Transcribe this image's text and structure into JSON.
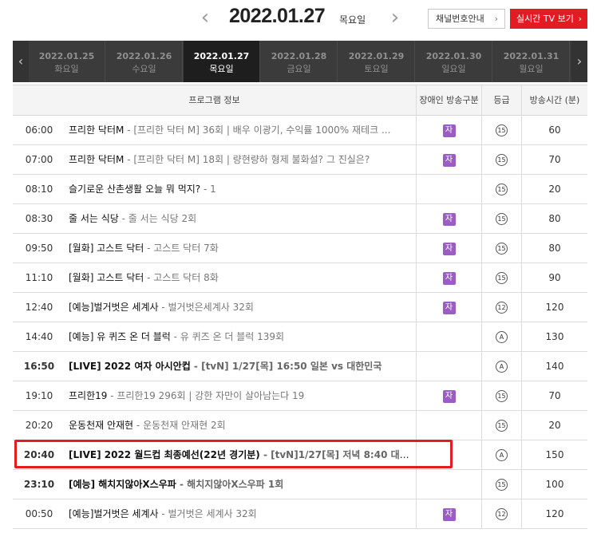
{
  "header": {
    "prev_icon": "chevron-left-icon",
    "next_icon": "chevron-right-icon",
    "date": "2022.01.27",
    "day_of_week": "목요일",
    "channel_guide_label": "채널번호안내",
    "live_tv_label": "실시간 TV 보기",
    "live_tv_color": "#e31c24"
  },
  "tabs": [
    {
      "date": "2022.01.25",
      "dow": "화요일"
    },
    {
      "date": "2022.01.26",
      "dow": "수요일"
    },
    {
      "date": "2022.01.27",
      "dow": "목요일"
    },
    {
      "date": "2022.01.28",
      "dow": "금요일"
    },
    {
      "date": "2022.01.29",
      "dow": "토요일"
    },
    {
      "date": "2022.01.30",
      "dow": "일요일"
    },
    {
      "date": "2022.01.31",
      "dow": "월요일"
    }
  ],
  "columns": {
    "program": "프로그램 정보",
    "accessibility": "장애인 방송구분",
    "rating": "등급",
    "duration": "방송시간 (분)"
  },
  "rows": [
    {
      "time": "06:00",
      "title": "프리한 닥터M",
      "sub": " - [프리한 닥터 M] 36회 | 배우 이광기, 수익률 1000% 재테크 ...",
      "cc": "자",
      "rating": "15",
      "duration": "60",
      "live": false
    },
    {
      "time": "07:00",
      "title": "프리한 닥터M",
      "sub": " - [프리한 닥터 M] 18회 | 량현량하 형제 불화설? 그 진실은?",
      "cc": "자",
      "rating": "15",
      "duration": "70",
      "live": false
    },
    {
      "time": "08:10",
      "title": "슬기로운 산촌생활 오늘 뭐 먹지?",
      "sub": " - 1",
      "cc": "",
      "rating": "15",
      "duration": "20",
      "live": false
    },
    {
      "time": "08:30",
      "title": "줄 서는 식당",
      "sub": " - 줄 서는 식당 2회",
      "cc": "자",
      "rating": "15",
      "duration": "80",
      "live": false
    },
    {
      "time": "09:50",
      "title": "[월화] 고스트 닥터",
      "sub": " - 고스트 닥터 7화",
      "cc": "자",
      "rating": "15",
      "duration": "80",
      "live": false
    },
    {
      "time": "11:10",
      "title": "[월화] 고스트 닥터",
      "sub": " - 고스트 닥터 8화",
      "cc": "자",
      "rating": "15",
      "duration": "90",
      "live": false
    },
    {
      "time": "12:40",
      "title": "[예능]벌거벗은 세계사",
      "sub": " - 벌거벗은세계사 32회",
      "cc": "자",
      "rating": "12",
      "duration": "120",
      "live": false
    },
    {
      "time": "14:40",
      "title": "[예능] 유 퀴즈 온 더 블럭",
      "sub": " - 유 퀴즈 온 더 블럭 139회",
      "cc": "",
      "rating": "A",
      "duration": "130",
      "live": false
    },
    {
      "time": "16:50",
      "title": "[LIVE] 2022 여자 아시안컵",
      "sub": " - [tvN] 1/27[목] 16:50 일본 vs 대한민국",
      "cc": "",
      "rating": "A",
      "duration": "140",
      "live": true
    },
    {
      "time": "19:10",
      "title": "프리한19",
      "sub": " - 프리한19 296회 | 강한 자만이 살아남는다 19",
      "cc": "자",
      "rating": "15",
      "duration": "70",
      "live": false
    },
    {
      "time": "20:20",
      "title": "운동천재 안재현",
      "sub": " - 운동천재 안재현 2회",
      "cc": "",
      "rating": "15",
      "duration": "20",
      "live": false
    },
    {
      "time": "20:40",
      "title": "[LIVE] 2022 월드컵 최종예선(22년 경기분)",
      "sub": " - [tvN]1/27[목] 저녁 8:40 대한...",
      "cc": "",
      "rating": "A",
      "duration": "150",
      "live": true
    },
    {
      "time": "23:10",
      "title": "[예능] 해치지않아X스우파",
      "sub": " - 해치지않아X스우파 1회",
      "cc": "",
      "rating": "15",
      "duration": "100",
      "live": true
    },
    {
      "time": "00:50",
      "title": "[예능]벌거벗은 세계사",
      "sub": " - 벌거벗은 세계사 32회",
      "cc": "자",
      "rating": "12",
      "duration": "120",
      "live": false
    }
  ],
  "accent_cc_color": "#9b5dc4",
  "highlight_color": "#e31c24"
}
